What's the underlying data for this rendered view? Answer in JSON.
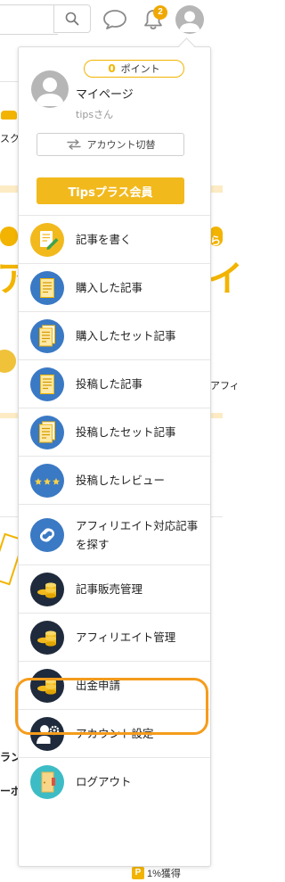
{
  "header": {
    "search_placeholder": "",
    "notification_count": "2"
  },
  "user_menu": {
    "points": {
      "value": "0",
      "label": "ポイント"
    },
    "mypage_label": "マイページ",
    "username": "tipsさん",
    "switch_account_label": "アカウント切替",
    "tips_plus_label": "Tipsプラス会員",
    "items": [
      {
        "label": "記事を書く",
        "icon": "write-article-icon"
      },
      {
        "label": "購入した記事",
        "icon": "document-icon"
      },
      {
        "label": "購入したセット記事",
        "icon": "document-icon"
      },
      {
        "label": "投稿した記事",
        "icon": "document-icon"
      },
      {
        "label": "投稿したセット記事",
        "icon": "document-icon"
      },
      {
        "label": "投稿したレビュー",
        "icon": "stars-icon"
      },
      {
        "label": "アフィリエイト対応記事を探す",
        "icon": "link-icon"
      },
      {
        "label": "記事販売管理",
        "icon": "coins-icon"
      },
      {
        "label": "アフィリエイト管理",
        "icon": "coins-icon"
      },
      {
        "label": "出金申請",
        "icon": "coins-icon"
      },
      {
        "label": "アカウント設定",
        "icon": "user-gear-icon"
      },
      {
        "label": "ログアウト",
        "icon": "logout-door-icon"
      }
    ],
    "highlighted_item": "出金申請"
  },
  "background_page": {
    "fragments": [
      "スク",
      "ら",
      "ア",
      "イ",
      "アフィ",
      "ラン",
      "ーボ"
    ],
    "footer_text": "1%獲得"
  },
  "colors": {
    "brand_yellow": "#f2b400",
    "icon_navy": "#1f2b3c",
    "icon_blue": "#3a79c4",
    "highlight_orange": "#f59c1c"
  }
}
